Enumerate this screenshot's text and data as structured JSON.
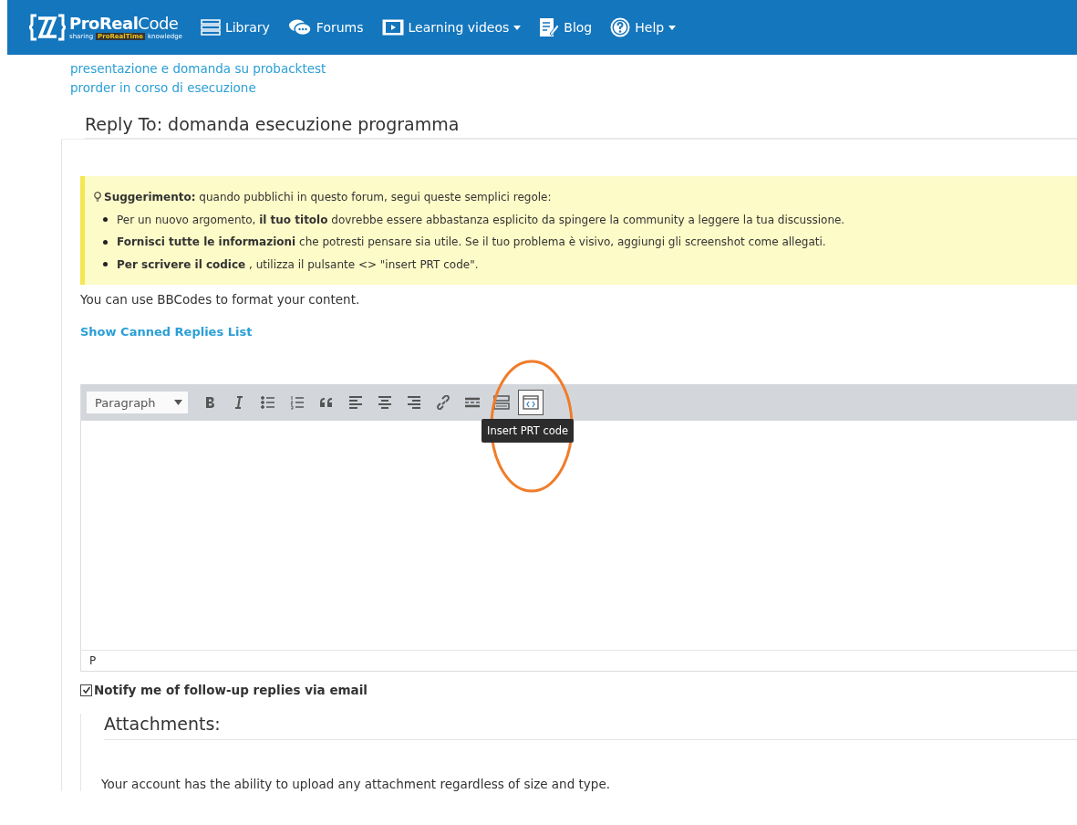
{
  "navbar": {
    "logo": {
      "name_bold": "ProReal",
      "name_light": "Code",
      "tagline_left": "sharing",
      "tagline_badge": "ProRealTime",
      "tagline_right": "knowledge"
    },
    "items": [
      {
        "label": "Library",
        "kind": "library",
        "dropdown": false
      },
      {
        "label": "Forums",
        "kind": "forums",
        "dropdown": false
      },
      {
        "label": "Learning videos",
        "kind": "videos",
        "dropdown": true
      },
      {
        "label": "Blog",
        "kind": "blog",
        "dropdown": false
      },
      {
        "label": "Help",
        "kind": "help",
        "dropdown": true
      }
    ]
  },
  "related_links": [
    "presentazione e domanda su probacktest",
    "prorder in corso di esecuzione"
  ],
  "reply_title": "Reply To: domanda esecuzione programma",
  "tip": {
    "heading": "**Suggerimento:** quando pubblichi in questo forum, segui queste semplici regole:",
    "rules": [
      "Per un nuovo argomento, **il tuo titolo** dovrebbe essere abbastanza esplicito da spingere la community a leggere la tua discussione.",
      "**Fornisci tutte le informazioni** che potresti pensare sia utile. Se il tuo problema è visivo, aggiungi gli screenshot come allegati.",
      "**Per scrivere il codice** , utilizza il pulsante <> \"insert PRT code\"."
    ]
  },
  "bbcodes_note": "You can use BBCodes to format your content.",
  "canned_replies_link": "Show Canned Replies List",
  "editor": {
    "format_select": "Paragraph",
    "toolbar": [
      {
        "kind": "bold",
        "selected": false
      },
      {
        "kind": "italic",
        "selected": false
      },
      {
        "kind": "bullet-list",
        "selected": false
      },
      {
        "kind": "numbered-list",
        "selected": false
      },
      {
        "kind": "quote",
        "selected": false
      },
      {
        "kind": "align-left",
        "selected": false
      },
      {
        "kind": "align-center",
        "selected": false
      },
      {
        "kind": "align-right",
        "selected": false
      },
      {
        "kind": "link",
        "selected": false
      },
      {
        "kind": "more",
        "selected": false
      },
      {
        "kind": "toolbar-toggle",
        "selected": false
      },
      {
        "kind": "code",
        "selected": true
      }
    ],
    "tooltip": "Insert PRT code",
    "status_path": "P"
  },
  "notify": {
    "label": "Notify me of follow-up replies via email",
    "checked": true
  },
  "attachments": {
    "title": "Attachments:",
    "note": "Your account has the ability to upload any attachment regardless of size and type."
  }
}
